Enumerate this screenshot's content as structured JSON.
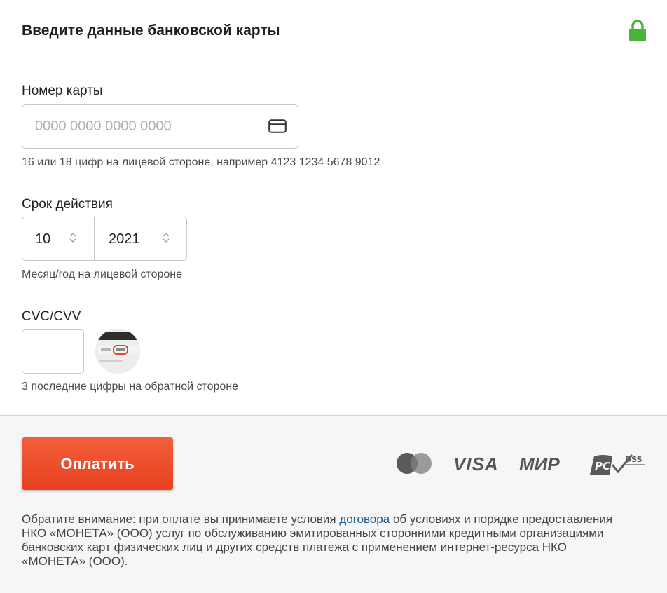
{
  "header": {
    "title": "Введите данные банковской карты",
    "lock_icon": "lock-icon",
    "lock_color": "#4bb33a"
  },
  "card_number": {
    "label": "Номер карты",
    "placeholder": "0000 0000 0000 0000",
    "value": "",
    "icon": "credit-card-icon",
    "hint": "16 или 18 цифр на лицевой стороне, например 4123 1234 5678 9012"
  },
  "expiry": {
    "label": "Срок действия",
    "month": "10",
    "year": "2021",
    "hint": "Месяц/год на лицевой стороне"
  },
  "cvc": {
    "label": "CVC/CVV",
    "value": "",
    "hint": "3 последние цифры на обратной стороне",
    "image_icon": "card-back-cvc-icon"
  },
  "footer": {
    "pay_label": "Оплатить",
    "pay_color": "#ea4a27",
    "logos": {
      "visa": "VISA",
      "mir": "МИР"
    },
    "notice_before": "Обратите внимание: при оплате вы принимаете условия ",
    "notice_link": "договора",
    "notice_after": " об условиях и порядке предоставления НКО «МОНЕТА» (ООО) услуг по обслуживанию эмитированных сторонними кредитными организациями банковских карт физических лиц и других средств платежа с применением интернет-ресурса НКО «МОНЕТА» (ООО)."
  }
}
